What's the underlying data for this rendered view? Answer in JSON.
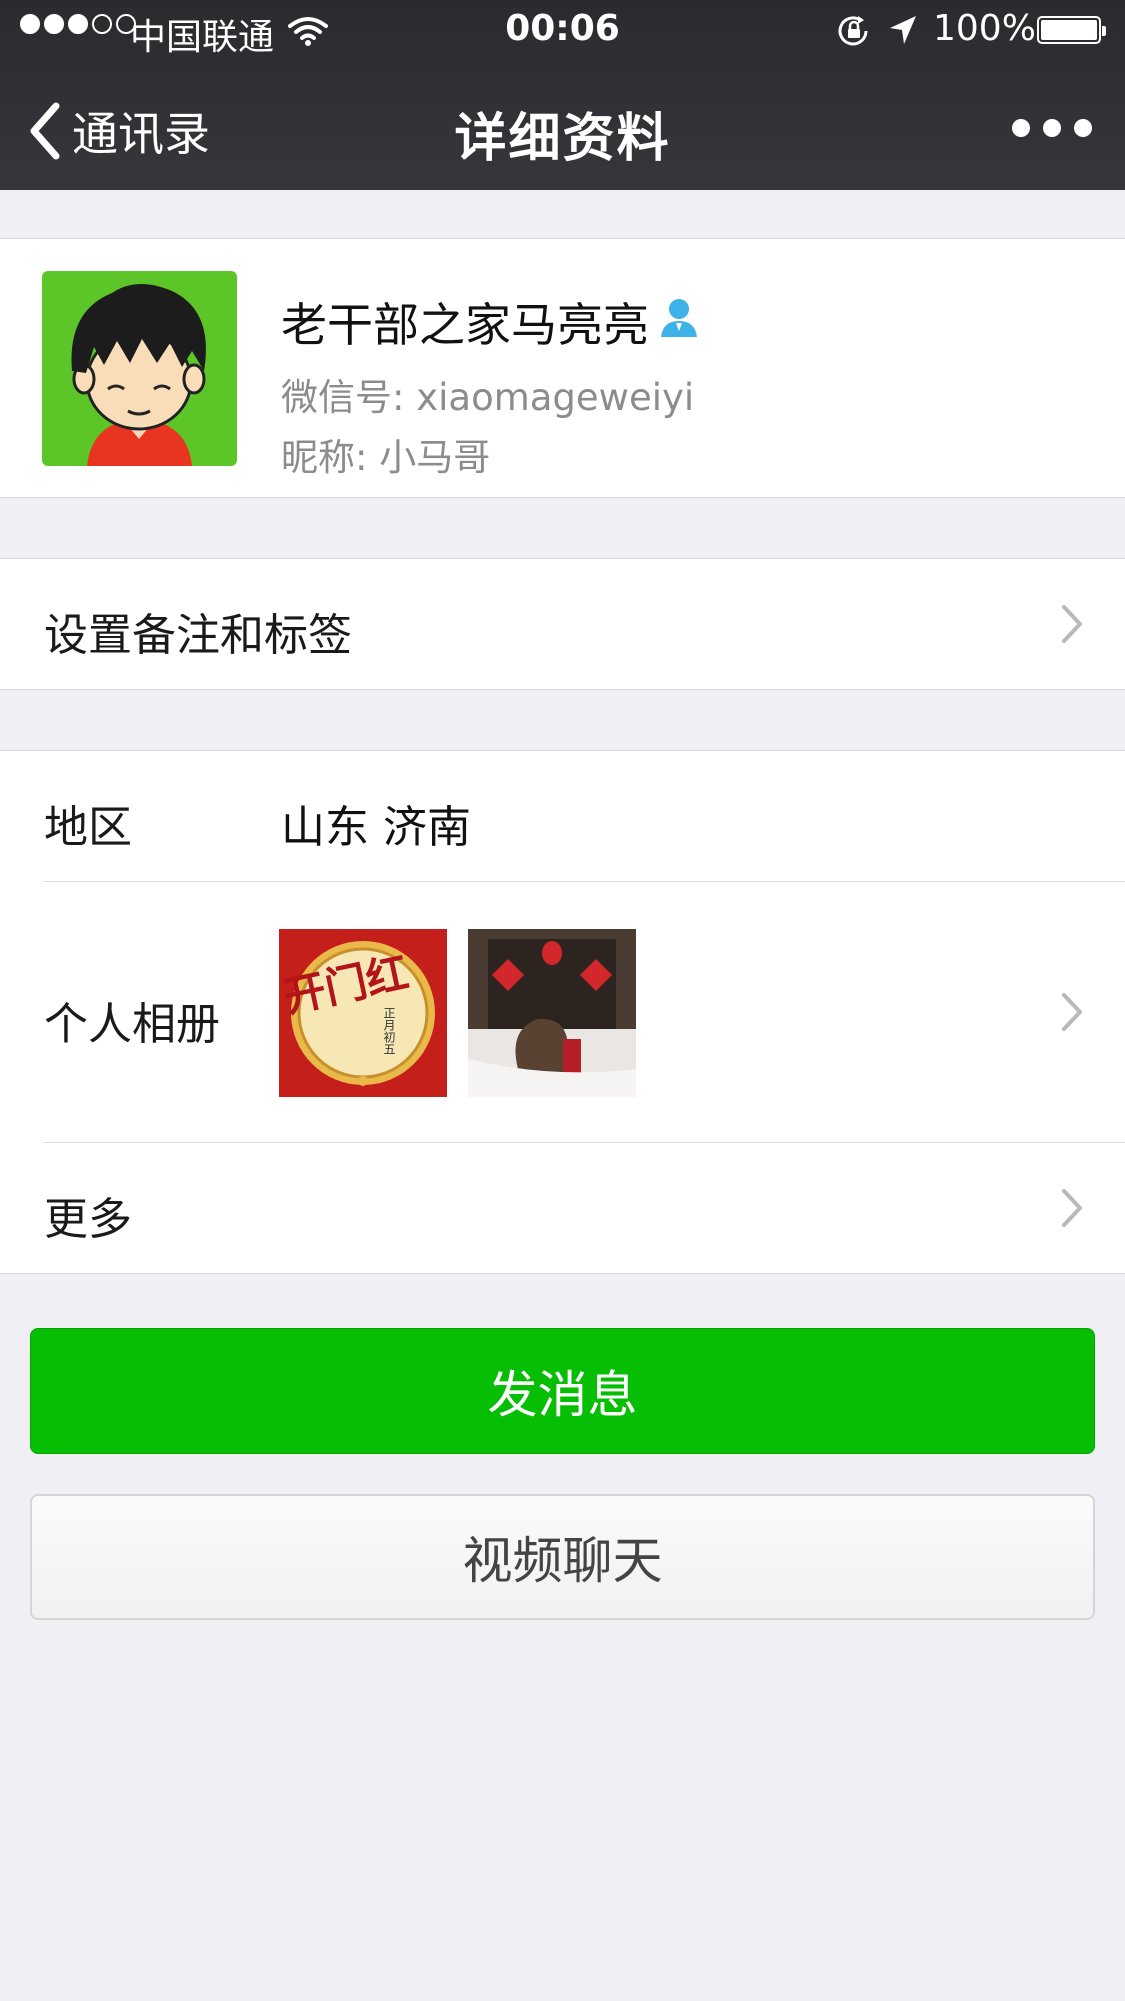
{
  "status_bar": {
    "carrier": "中国联通",
    "time": "00:06",
    "battery": "100%"
  },
  "nav": {
    "back_label": "通讯录",
    "title": "详细资料"
  },
  "profile": {
    "name": "老干部之家马亮亮",
    "wechat_id": "微信号: xiaomageweiyi",
    "nickname": "昵称: 小马哥"
  },
  "remark_row": {
    "label": "设置备注和标签"
  },
  "info": {
    "region_label": "地区",
    "region_value": "山东 济南",
    "album_label": "个人相册",
    "more_label": "更多",
    "album_thumb_text": [
      "开门红",
      "正月初五"
    ]
  },
  "actions": {
    "send_message": "发消息",
    "video_chat": "视频聊天"
  },
  "colors": {
    "nav_bg": "#2e3034",
    "send_button": "#06be04",
    "avatar_bg": "#5cc527",
    "verified_icon": "#3db2e8"
  },
  "icons": [
    "signal-dots-icon",
    "wifi-icon",
    "rotation-lock-icon",
    "location-arrow-icon",
    "battery-icon",
    "back-chevron-icon",
    "more-dots-icon",
    "verified-user-icon",
    "chevron-right-icon"
  ]
}
